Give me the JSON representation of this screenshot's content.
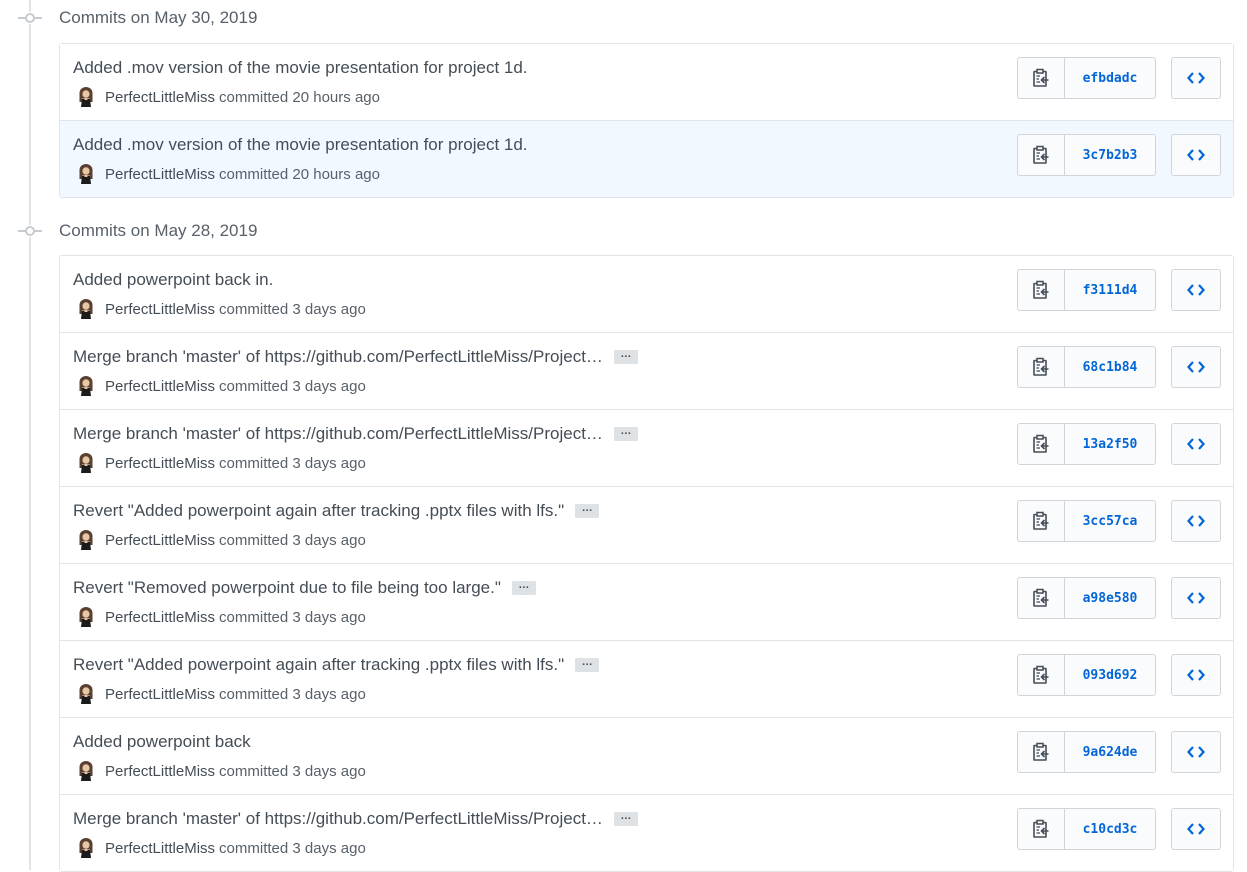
{
  "colors": {
    "link": "#0366d6",
    "border": "#e1e4e8",
    "highlight_row": "#f1f8ff",
    "muted_text": "#586069",
    "title_text": "#444d56"
  },
  "groups": [
    {
      "title": "Commits on May 30, 2019",
      "commits": [
        {
          "message": "Added .mov version of the movie presentation for project 1d.",
          "has_more": false,
          "author": "PerfectLittleMiss",
          "committed": "committed 20 hours ago",
          "sha": "efbdadc",
          "highlighted": false
        },
        {
          "message": "Added .mov version of the movie presentation for project 1d.",
          "has_more": false,
          "author": "PerfectLittleMiss",
          "committed": "committed 20 hours ago",
          "sha": "3c7b2b3",
          "highlighted": true
        }
      ]
    },
    {
      "title": "Commits on May 28, 2019",
      "commits": [
        {
          "message": "Added powerpoint back in.",
          "has_more": false,
          "author": "PerfectLittleMiss",
          "committed": "committed 3 days ago",
          "sha": "f3111d4",
          "highlighted": false
        },
        {
          "message": "Merge branch 'master' of https://github.com/PerfectLittleMiss/Project…",
          "has_more": true,
          "author": "PerfectLittleMiss",
          "committed": "committed 3 days ago",
          "sha": "68c1b84",
          "highlighted": false
        },
        {
          "message": "Merge branch 'master' of https://github.com/PerfectLittleMiss/Project…",
          "has_more": true,
          "author": "PerfectLittleMiss",
          "committed": "committed 3 days ago",
          "sha": "13a2f50",
          "highlighted": false
        },
        {
          "message": "Revert \"Added powerpoint again after tracking .pptx files with lfs.\"",
          "has_more": true,
          "author": "PerfectLittleMiss",
          "committed": "committed 3 days ago",
          "sha": "3cc57ca",
          "highlighted": false
        },
        {
          "message": "Revert \"Removed powerpoint due to file being too large.\"",
          "has_more": true,
          "author": "PerfectLittleMiss",
          "committed": "committed 3 days ago",
          "sha": "a98e580",
          "highlighted": false
        },
        {
          "message": "Revert \"Added powerpoint again after tracking .pptx files with lfs.\"",
          "has_more": true,
          "author": "PerfectLittleMiss",
          "committed": "committed 3 days ago",
          "sha": "093d692",
          "highlighted": false
        },
        {
          "message": "Added powerpoint back",
          "has_more": false,
          "author": "PerfectLittleMiss",
          "committed": "committed 3 days ago",
          "sha": "9a624de",
          "highlighted": false
        },
        {
          "message": "Merge branch 'master' of https://github.com/PerfectLittleMiss/Project…",
          "has_more": true,
          "author": "PerfectLittleMiss",
          "committed": "committed 3 days ago",
          "sha": "c10cd3c",
          "highlighted": false
        }
      ]
    }
  ],
  "ellipsis_label": "…",
  "icons": {
    "timeline": "git-commit-icon",
    "copy": "clippy-icon",
    "browse": "code-icon",
    "avatar": "user-avatar"
  }
}
